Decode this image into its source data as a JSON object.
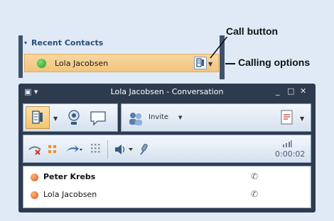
{
  "recent_contacts": {
    "header": "Recent Contacts",
    "expand_glyph": "▾",
    "contact_name": "Lola Jacobsen",
    "status_color": "#2aa52a"
  },
  "callouts": {
    "call_button": "Call button",
    "calling_options": "Calling options"
  },
  "window": {
    "title": "Lola Jacobsen - Conversation",
    "controls": [
      "_",
      "□",
      "✕"
    ]
  },
  "toolbar": {
    "invite_label": "Invite",
    "timer": "0:00:02"
  },
  "participants": [
    {
      "name": "Peter Krebs",
      "bold": true
    },
    {
      "name": "Lola Jacobsen",
      "bold": false
    }
  ],
  "colors": {
    "accent_orange": "#f1c57d",
    "window_frame": "#2e3b4e",
    "presence_busy": "#e0501d",
    "presence_available": "#1f9a23"
  }
}
